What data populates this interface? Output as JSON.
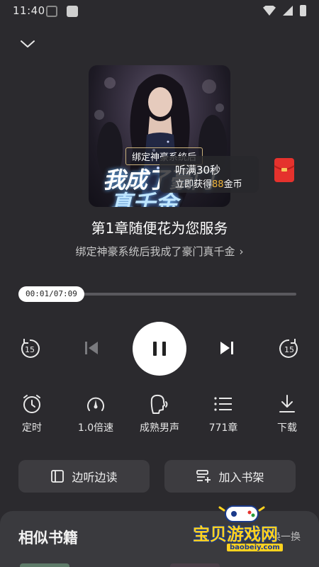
{
  "status_bar": {
    "time": "11:40"
  },
  "cover": {
    "banner": "绑定神豪系统后",
    "title_line1": "我成了豪门",
    "title_line2": "真千金"
  },
  "reward": {
    "line1": "听满30秒",
    "line2_prefix": "立即获得",
    "line2_amount": "88",
    "line2_suffix": "金币"
  },
  "chapter": {
    "title": "第1章随便花为您服务"
  },
  "book": {
    "name": "绑定神豪系统后我成了豪门真千金",
    "chevron": "›"
  },
  "progress": {
    "current": "00:01",
    "total": "07:09",
    "label": "00:01/07:09",
    "fraction": 0.0023
  },
  "controls": {
    "rewind_label": "15",
    "forward_label": "15",
    "state": "playing",
    "icons": [
      "rewind-15-icon",
      "previous-icon",
      "pause-icon",
      "next-icon",
      "forward-15-icon"
    ]
  },
  "functions": [
    {
      "label": "定时",
      "icon": "timer-clock-icon"
    },
    {
      "label": "1.0倍速",
      "icon": "speed-gauge-icon"
    },
    {
      "label": "成熟男声",
      "icon": "voice-head-icon"
    },
    {
      "label": "771章",
      "icon": "chapter-list-icon"
    },
    {
      "label": "下载",
      "icon": "download-icon"
    }
  ],
  "actions": {
    "listen_read": "边听边读",
    "add_shelf": "加入书架"
  },
  "similar": {
    "title": "相似书籍",
    "action": "换一换"
  },
  "watermark": {
    "text": "宝贝游戏网",
    "url": "baobeiy.com"
  },
  "colors": {
    "background": "#2b2a2e",
    "reward_highlight": "#f0b43a",
    "red_packet": "#e5322d"
  }
}
